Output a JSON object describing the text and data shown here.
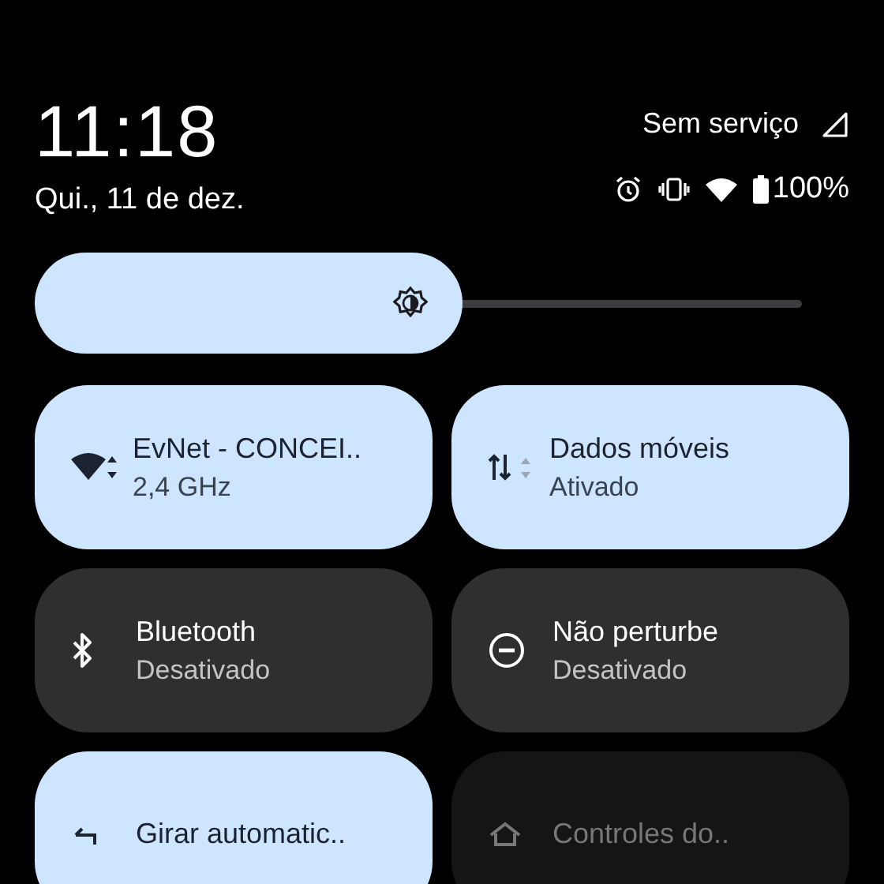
{
  "header": {
    "time": "11:18",
    "date": "Qui., 11 de dez.",
    "carrier": "Sem serviço",
    "battery": "100%"
  },
  "brightness": {
    "level": 0.525
  },
  "tiles": [
    {
      "kind": "on",
      "title": "EvNet - CONCEI..",
      "subtitle": "2,4 GHz"
    },
    {
      "kind": "on",
      "title": "Dados móveis",
      "subtitle": "Ativado"
    },
    {
      "kind": "off",
      "title": "Bluetooth",
      "subtitle": "Desativado"
    },
    {
      "kind": "off",
      "title": "Não perturbe",
      "subtitle": "Desativado"
    },
    {
      "kind": "on",
      "title": "Girar automatic.."
    },
    {
      "kind": "unavailable",
      "title": "Controles do.."
    }
  ]
}
